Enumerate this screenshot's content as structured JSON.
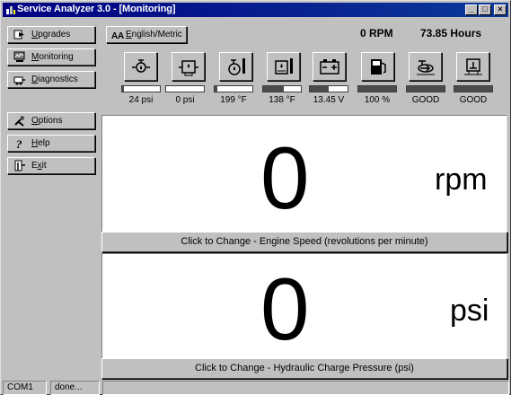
{
  "window": {
    "title": "Service Analyzer 3.0 - [Monitoring]",
    "minimize_glyph": "_",
    "maximize_glyph": "□",
    "close_glyph": "×"
  },
  "nav": {
    "upgrades": {
      "accel": "U",
      "rest": "pgrades",
      "icon": "upgrade-arrow-icon"
    },
    "monitoring": {
      "accel": "M",
      "rest": "onitoring",
      "icon": "monitor-icon"
    },
    "diagnostics": {
      "accel": "D",
      "rest": "iagnostics",
      "icon": "diagnostics-icon"
    },
    "options": {
      "accel": "O",
      "rest": "ptions",
      "icon": "options-icon"
    },
    "help": {
      "accel": "H",
      "rest": "elp",
      "icon": "question-mark-icon"
    },
    "exit": {
      "pre": "E",
      "accel": "x",
      "rest": "it",
      "icon": "exit-door-icon"
    }
  },
  "header": {
    "units_button": {
      "accel": "E",
      "rest": "nglish/Metric",
      "icon": "units-icon"
    },
    "rpm_readout": "0 RPM",
    "hours_readout": "73.85 Hours"
  },
  "gauges": [
    {
      "name": "oil-pressure",
      "icon": "oil-can-icon",
      "value": "24 psi",
      "level": 0.04,
      "color_fill": "#4a4a4a"
    },
    {
      "name": "charge-pressure",
      "icon": "hydraulic-pressure-icon",
      "value": "0 psi",
      "level": 0.0,
      "color_fill": "#4a4a4a"
    },
    {
      "name": "oil-temperature",
      "icon": "oil-temp-icon",
      "value": "199 °F",
      "level": 0.06,
      "color_fill": "#4a4a4a"
    },
    {
      "name": "hydraulic-temperature",
      "icon": "hydraulic-temp-icon",
      "value": "138 °F",
      "level": 0.55,
      "color_fill": "#4a4a4a"
    },
    {
      "name": "battery-voltage",
      "icon": "battery-icon",
      "value": "13.45  V",
      "level": 0.5,
      "color_fill": "#4a4a4a"
    },
    {
      "name": "fuel-level",
      "icon": "fuel-pump-icon",
      "value": "100 %",
      "level": 1.0,
      "color_fill": "#4a4a4a"
    },
    {
      "name": "filter-status",
      "icon": "filter-icon",
      "value": "GOOD",
      "level": 1.0,
      "color_fill": "#4a4a4a"
    },
    {
      "name": "hydraulic-filter-status",
      "icon": "hydraulic-filter-icon",
      "value": "GOOD",
      "level": 1.0,
      "color_fill": "#4a4a4a"
    }
  ],
  "panels": {
    "engine_speed": {
      "value": "0",
      "unit": "rpm",
      "caption": "Click to Change - Engine Speed (revolutions per minute)"
    },
    "charge_pressure": {
      "value": "0",
      "unit": "psi",
      "caption": "Click to Change - Hydraulic Charge Pressure (psi)"
    }
  },
  "status": {
    "port": "COM1",
    "message": "done..."
  }
}
